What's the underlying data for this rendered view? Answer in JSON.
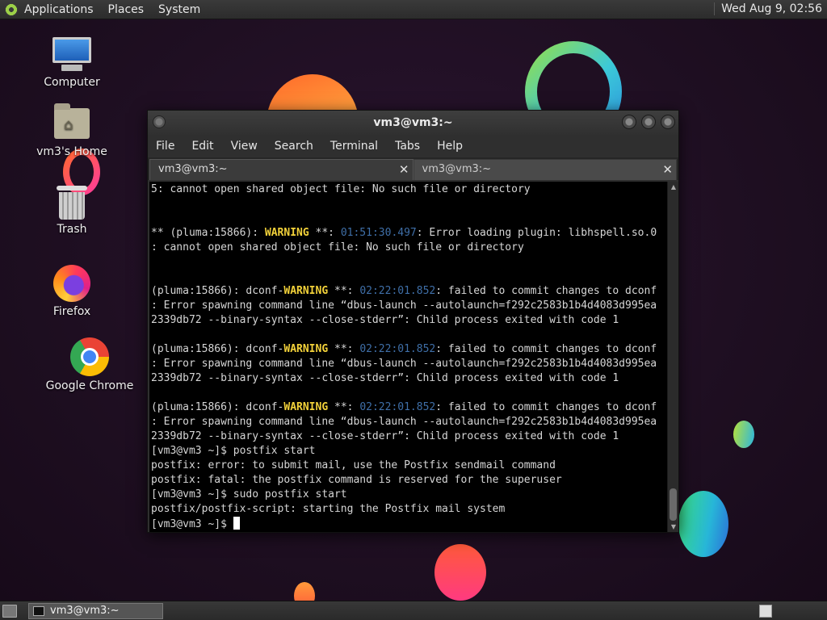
{
  "top_panel": {
    "menus": [
      "Applications",
      "Places",
      "System"
    ],
    "clock": "Wed Aug  9, 02:56"
  },
  "desktop_icons": [
    {
      "label": "Computer",
      "icon": "computer-icon"
    },
    {
      "label": "vm3's Home",
      "icon": "home-folder-icon"
    },
    {
      "label": "Trash",
      "icon": "trash-icon"
    },
    {
      "label": "Firefox",
      "icon": "firefox-icon"
    },
    {
      "label": "Google Chrome",
      "icon": "chrome-icon"
    }
  ],
  "terminal": {
    "title": "vm3@vm3:~",
    "menu": [
      "File",
      "Edit",
      "View",
      "Search",
      "Terminal",
      "Tabs",
      "Help"
    ],
    "tabs": [
      {
        "label": "vm3@vm3:~",
        "close": "✕"
      },
      {
        "label": "vm3@vm3:~",
        "close": "✕"
      }
    ],
    "lines": {
      "l1": "5: cannot open shared object file: No such file or directory",
      "l2a": "** (pluma:15866): ",
      "l2w": "WARNING",
      "l2b": " **: ",
      "l2t": "01:51:30.497",
      "l2c": ": Error loading plugin: libhspell.so.0",
      "l3": ": cannot open shared object file: No such file or directory",
      "dconf_a": "(pluma:15866): dconf-",
      "dconf_w": "WARNING",
      "dconf_b": " **: ",
      "dconf_t": "02:22:01.852",
      "dconf_c": ": failed to commit changes to dconf",
      "dconf_2": ": Error spawning command line “dbus-launch --autolaunch=f292c2583b1b4d4083d995ea",
      "dconf_3": "2339db72 --binary-syntax --close-stderr”: Child process exited with code 1",
      "p1": "[vm3@vm3 ~]$ postfix start",
      "p2": "postfix: error: to submit mail, use the Postfix sendmail command",
      "p3": "postfix: fatal: the postfix command is reserved for the superuser",
      "p4": "[vm3@vm3 ~]$ sudo postfix start",
      "p5": "postfix/postfix-script: starting the Postfix mail system",
      "p6": "[vm3@vm3 ~]$ "
    }
  },
  "bottom_panel": {
    "task_label": "vm3@vm3:~"
  },
  "colors": {
    "warning": "#f3d23a",
    "timestamp": "#3f6fa8",
    "terminal_bg": "#000000"
  }
}
